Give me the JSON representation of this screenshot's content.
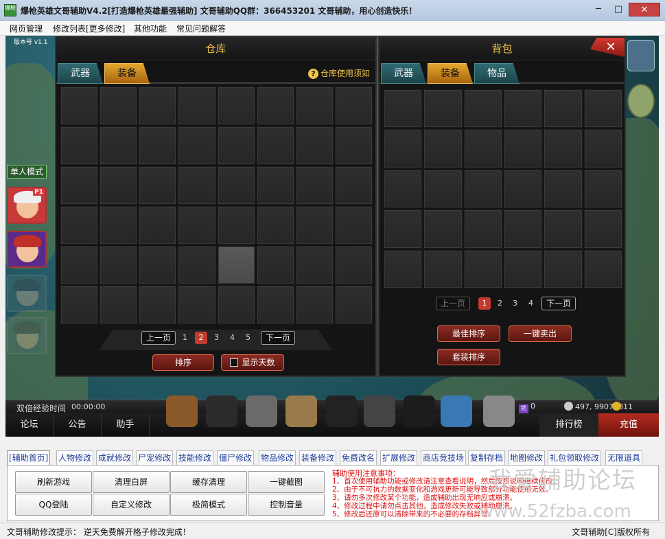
{
  "window": {
    "icon_text": "爆枪",
    "title": "爆枪英雄文哥辅助V4.2[打造爆枪英雄最强辅助]    文哥辅助QQ群：366453201 文哥辅助，用心创造快乐！",
    "min": "─",
    "max": "□",
    "close": "✕"
  },
  "menu": [
    "网页管理",
    "修改列表[更多修改]",
    "其他功能",
    "常见问题解答"
  ],
  "game": {
    "version": "版本号 v1.1",
    "single_mode": "单人模式",
    "p1_badge": "P1",
    "storage": {
      "title": "仓库",
      "tabs": [
        "武器",
        "装备"
      ],
      "active_tab": 1,
      "help": "仓库使用须知",
      "help_icon": "?",
      "rows": 6,
      "cols": 8,
      "selected_cell": 36,
      "pager": {
        "prev": "上一页",
        "pages": [
          "1",
          "2",
          "3",
          "4",
          "5"
        ],
        "current": 1,
        "next": "下一页"
      },
      "sort": "排序",
      "show_days": "显示天数"
    },
    "bag": {
      "title": "背包",
      "tabs": [
        "武器",
        "装备",
        "物品"
      ],
      "active_tab": 1,
      "rows": 5,
      "cols": 6,
      "pager": {
        "prev": "上一页",
        "pages": [
          "1",
          "2",
          "3",
          "4"
        ],
        "current": 0,
        "next": "下一页"
      },
      "best_sort": "最佳排序",
      "sell_all": "一键卖出",
      "suit_sort": "套装排序"
    },
    "close_panel": "✕",
    "hud": {
      "exp_label": "双倍经验时间",
      "exp_time": "00:00:00",
      "gem_icon": "钯",
      "gem": "0",
      "silver": "497, 990748",
      "gold": "11",
      "nav": [
        "论坛",
        "公告",
        "助手"
      ],
      "rank": "排行榜",
      "charge": "充值",
      "icons": [
        "backpack-icon",
        "skill-icon",
        "scroll-icon",
        "forge-hammer-icon",
        "mask-icon",
        "bullets-icon",
        "hood-icon",
        "shop-icon",
        "settings-gear-icon"
      ]
    }
  },
  "tool": {
    "tabs": [
      "[辅助首页]",
      "人物修改",
      "成就修改",
      "尸宠修改",
      "技能修改",
      "僵尸修改",
      "物品修改",
      "装备修改",
      "免费改名",
      "扩展修改",
      "商店竞技场",
      "复制存档",
      "地图修改",
      "礼包领取修改",
      "无限道具"
    ],
    "buttons": [
      "刷新游戏",
      "清理白屏",
      "缓存清理",
      "一键截图",
      "QQ登陆",
      "自定义修改",
      "极简模式",
      "控制音量"
    ],
    "notes_title": "辅助使用注意事项：",
    "notes": [
      "1、首次使用辅助功能或修改请注意查看说明，然后按照说明继续修改。",
      "2、由于不可抗力的数据变化和游戏更新可能导致部分功能使用无效。",
      "3、请勿多次修改某个功能，造成辅助出现无响应或崩溃。",
      "4、修改过程中请勿点击其他，造成修改失败或辅助崩溃。",
      "5、修改后还原可以清除带来的不必要的存档异常。"
    ],
    "watermark_cn": "我爱辅助论坛",
    "watermark_url": "www.52fzba.com"
  },
  "status": {
    "left": "文哥辅助修改提示：  逆天免费解开格子修改完成！",
    "right": "文哥辅助[C]版权所有"
  }
}
